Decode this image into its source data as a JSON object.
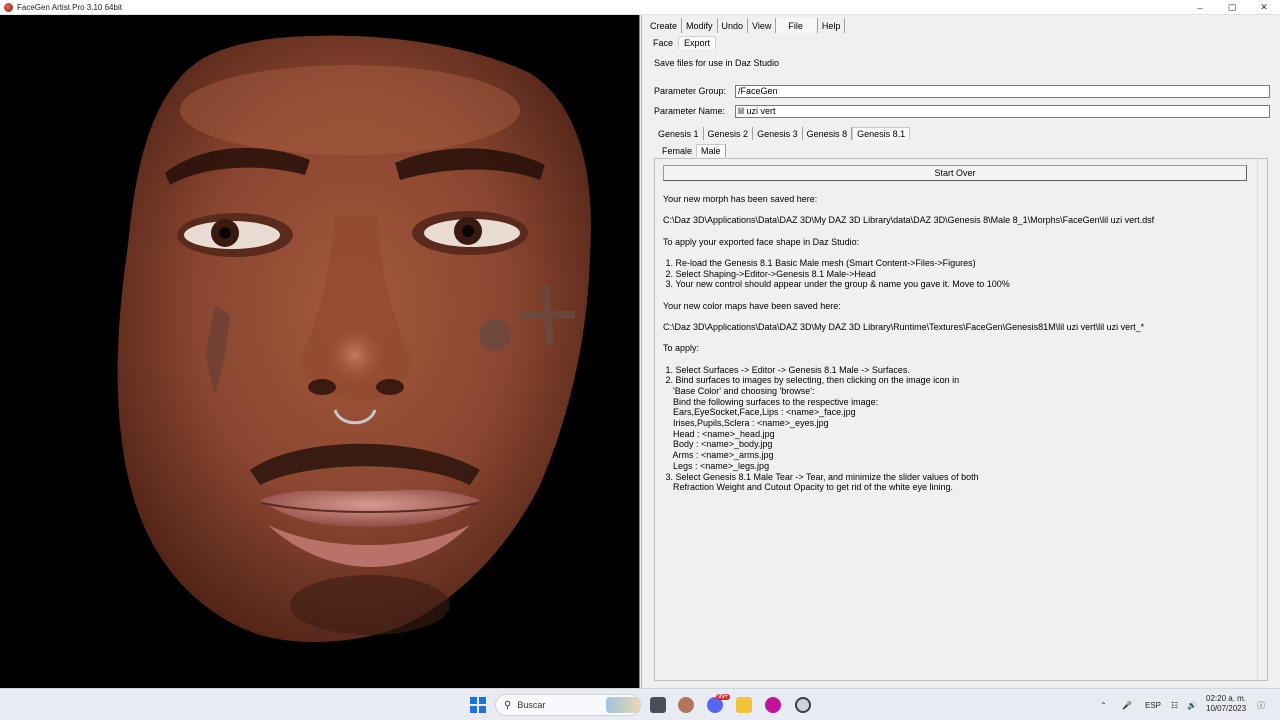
{
  "window": {
    "title": "FaceGen Artist Pro 3.10 64bit",
    "minimize_glyph": "–",
    "maximize_glyph": "▢",
    "close_glyph": "✕"
  },
  "menu": [
    {
      "label": "Create"
    },
    {
      "label": "Modify"
    },
    {
      "label": "Undo"
    },
    {
      "label": "View"
    },
    {
      "label": "File"
    },
    {
      "label": "Help"
    }
  ],
  "subtabs": [
    {
      "label": "Face"
    },
    {
      "label": "Export"
    }
  ],
  "header": "Save files for use in Daz Studio",
  "params": {
    "group_label": "Parameter Group:",
    "group_value": "/FaceGen",
    "name_label": "Parameter Name:",
    "name_value": "lil uzi vert"
  },
  "genesis_tabs": [
    {
      "label": "Genesis 1"
    },
    {
      "label": "Genesis 2"
    },
    {
      "label": "Genesis 3"
    },
    {
      "label": "Genesis 8"
    },
    {
      "label": "Genesis 8.1"
    }
  ],
  "sex_tabs": [
    {
      "label": "Female"
    },
    {
      "label": "Male"
    }
  ],
  "start_over": "Start Over",
  "content": {
    "morph_saved": "Your new morph has been saved here:",
    "morph_path": "C:\\Daz 3D\\Applications\\Data\\DAZ 3D\\My DAZ 3D Library\\data\\DAZ 3D\\Genesis 8\\Male 8_1\\Morphs\\FaceGen\\lil uzi vert.dsf",
    "apply_shape": "To apply your exported face shape in Daz Studio:",
    "shape_steps": [
      " 1. Re-load the Genesis 8.1 Basic Male mesh (Smart Content->Files->Figures)",
      " 2. Select Shaping->Editor->Genesis 8.1 Male->Head",
      " 3. Your new control should appear under the group & name you gave it. Move to 100%"
    ],
    "maps_saved": "Your new color maps have been saved here:",
    "maps_path": "C:\\Daz 3D\\Applications\\Data\\DAZ 3D\\My DAZ 3D Library\\Runtime\\Textures\\FaceGen\\Genesis81M\\lil uzi vert\\lil uzi vert_*",
    "to_apply": "To apply:",
    "apply_steps": [
      " 1. Select Surfaces -> Editor -> Genesis 8.1 Male -> Surfaces.",
      " 2. Bind surfaces to images by selecting, then clicking on the image icon in",
      "    'Base Color' and choosing 'browse':",
      "    Bind the following surfaces to the respective image:",
      "    Ears,EyeSocket,Face,Lips : <name>_face.jpg",
      "    Irises,Pupils,Sclera : <name>_eyes.jpg",
      "    Head : <name>_head.jpg",
      "    Body : <name>_body.jpg",
      "    Arms : <name>_arms.jpg",
      "    Legs : <name>_legs.jpg",
      " 3. Select Genesis 8.1 Male Tear -> Tear, and minimize the slider values of both",
      "    Refraction Weight and Cutout Opacity to get rid of the white eye lining."
    ]
  },
  "taskbar": {
    "search_placeholder": "Buscar",
    "lang": "ESP",
    "time": "02:20 a. m.",
    "date": "10/07/2023",
    "badge": "99+"
  },
  "icons": {
    "search": "search-icon",
    "wifi": "wifi-icon",
    "volume": "volume-icon"
  }
}
